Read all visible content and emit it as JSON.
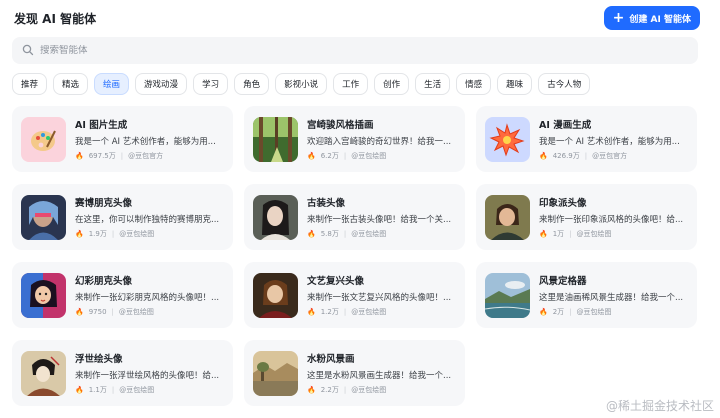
{
  "header": {
    "title": "发现 AI 智能体",
    "create_label": "创建 AI 智能体"
  },
  "search": {
    "placeholder": "搜索智能体"
  },
  "categories": [
    "推荐",
    "精选",
    "绘画",
    "游戏动漫",
    "学习",
    "角色",
    "影视小说",
    "工作",
    "创作",
    "生活",
    "情感",
    "趣味",
    "古今人物"
  ],
  "active_category": "绘画",
  "cards": [
    {
      "name": "AI 图片生成",
      "desc": "我是一个 AI 艺术创作者，能够为用...",
      "count": "697.5万",
      "author": "@豆包官方",
      "icon": "palette-icon"
    },
    {
      "name": "宫崎骏风格插画",
      "desc": "欢迎踏入宫崎骏的奇幻世界！给我一...",
      "count": "6.2万",
      "author": "@豆包绘图",
      "icon": "forest-image"
    },
    {
      "name": "AI 漫画生成",
      "desc": "我是一个 AI 艺术创作者，能够为用...",
      "count": "426.9万",
      "author": "@豆包官方",
      "icon": "comic-burst-icon"
    },
    {
      "name": "赛博朋克头像",
      "desc": "在这里，你可以制作独特的赛博朋克...",
      "count": "1.9万",
      "author": "@豆包绘图",
      "icon": "cyberpunk-portrait"
    },
    {
      "name": "古装头像",
      "desc": "来制作一张古装头像吧！给我一个关...",
      "count": "5.8万",
      "author": "@豆包绘图",
      "icon": "ancient-portrait"
    },
    {
      "name": "印象派头像",
      "desc": "来制作一张印象派风格的头像吧！给...",
      "count": "1万",
      "author": "@豆包绘图",
      "icon": "impressionist-portrait"
    },
    {
      "name": "幻彩朋克头像",
      "desc": "来制作一张幻彩朋克风格的头像吧！...",
      "count": "9750",
      "author": "@豆包绘图",
      "icon": "colorful-punk-portrait"
    },
    {
      "name": "文艺复兴头像",
      "desc": "来制作一张文艺复兴风格的头像吧！...",
      "count": "1.2万",
      "author": "@豆包绘图",
      "icon": "renaissance-portrait"
    },
    {
      "name": "风景定格器",
      "desc": "这里是油画稀风景生成器！给我一个...",
      "count": "2万",
      "author": "@豆包绘图",
      "icon": "landscape-painting"
    },
    {
      "name": "浮世绘头像",
      "desc": "来制作一张浮世绘风格的头像吧！给...",
      "count": "1.1万",
      "author": "@豆包绘图",
      "icon": "ukiyoe-portrait"
    },
    {
      "name": "水粉风景画",
      "desc": "这里是水粉风景画生成器！给我一个...",
      "count": "2.2万",
      "author": "@豆包绘图",
      "icon": "gouache-landscape"
    }
  ],
  "watermark": "@稀土掘金技术社区",
  "colors": {
    "accent": "#1f6bff",
    "chip_active_bg": "#e6efff",
    "card_bg": "#f6f7f9"
  }
}
